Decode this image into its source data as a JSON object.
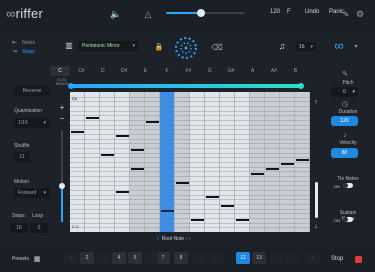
{
  "app": {
    "title": "riffer"
  },
  "header": {
    "tempo": "120",
    "time_signature": "F",
    "undo_label": "Undo",
    "panic_label": "Panic",
    "volume_level": 0.45
  },
  "toolbar": {
    "scale_value": "Pentatonic Minor",
    "steps_value": "16",
    "notes_label": "Notes",
    "steps_label": "Steps"
  },
  "keys": [
    "C",
    "C#",
    "D",
    "D#",
    "E",
    "F",
    "F#",
    "G",
    "G#",
    "A",
    "A#",
    "B"
  ],
  "key_range_label": "OCTA RANGE",
  "left_panel": {
    "reverse_label": "Reverse",
    "quantization_label": "Quantization",
    "quantization_value": "1/16",
    "shuffle_label": "Shuffle",
    "shuffle_value": "11",
    "motion_label": "Motion",
    "motion_value": "Forward",
    "steps_label": "Steps",
    "loop_label": "Loop",
    "steps_value": "16",
    "loop_value": "0"
  },
  "grid": {
    "top_row_label": "D#",
    "bottom_row_label": "C-2",
    "root_note_label": "Root Note",
    "highlight_col": 6
  },
  "right_panel": {
    "pitch_label": "Pitch",
    "pitch_value": "0",
    "duration_label": "Duration",
    "duration_value": "120",
    "velocity_label": "Velocity",
    "velocity_value": "80",
    "tie_notes_label": "Tie Notes",
    "tie_notes_state": "ON",
    "sustain_notes_label": "Sustain Notes",
    "sustain_notes_state": "ON"
  },
  "bottom": {
    "presets_label": "Presets",
    "pages": [
      "2",
      "4",
      "5",
      "7",
      "8",
      "12",
      "13"
    ],
    "active_page": "12",
    "stop_label": "Stop"
  },
  "colors": {
    "accent": "#2188e0",
    "background": "#1d2128"
  }
}
